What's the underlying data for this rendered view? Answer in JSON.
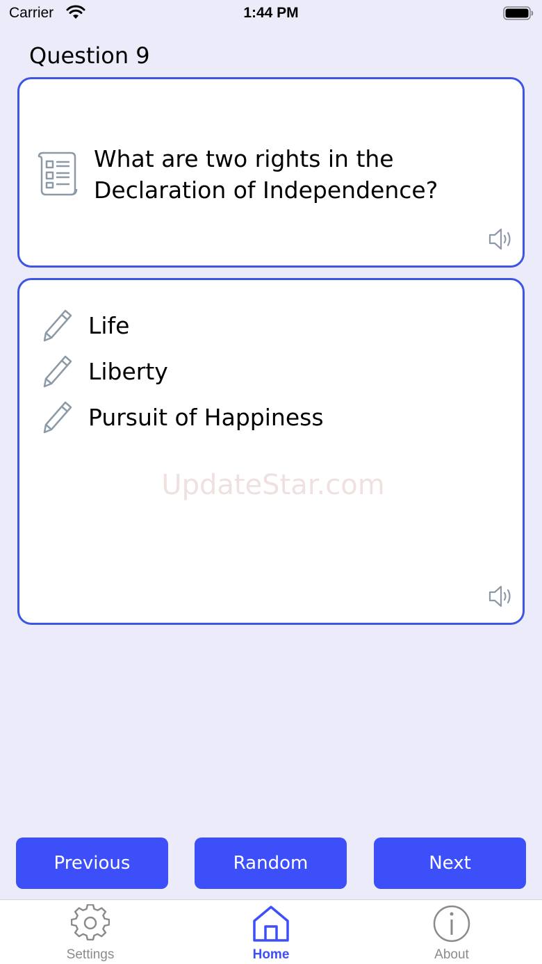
{
  "status_bar": {
    "carrier": "Carrier",
    "time": "1:44 PM"
  },
  "question": {
    "title": "Question 9",
    "text": "What are two rights in the Declaration of Independence?",
    "icon": "scroll-icon"
  },
  "answers": [
    {
      "text": "Life",
      "icon": "pencil-icon"
    },
    {
      "text": "Liberty",
      "icon": "pencil-icon"
    },
    {
      "text": "Pursuit of Happiness",
      "icon": "pencil-icon"
    }
  ],
  "watermark": "UpdateStar.com",
  "buttons": {
    "previous": "Previous",
    "random": "Random",
    "next": "Next"
  },
  "tabs": [
    {
      "label": "Settings",
      "icon": "gear-icon"
    },
    {
      "label": "Home",
      "icon": "home-icon",
      "active": true
    },
    {
      "label": "About",
      "icon": "info-icon"
    }
  ],
  "colors": {
    "accent": "#3d4ff8",
    "card_border": "#3d55e3",
    "background": "#ebebf9",
    "icon_gray": "#8899a6"
  }
}
